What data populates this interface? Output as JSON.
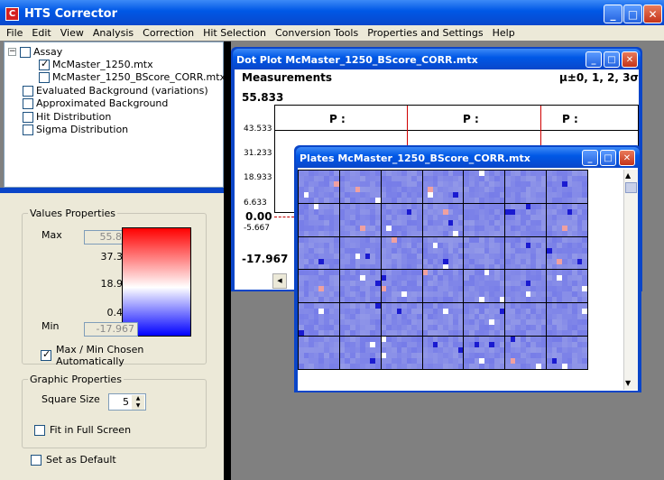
{
  "app": {
    "title": "HTS Corrector",
    "icon_letter": "C"
  },
  "menu": [
    "File",
    "Edit",
    "View",
    "Analysis",
    "Correction",
    "Hit Selection",
    "Conversion Tools",
    "Properties and Settings",
    "Help"
  ],
  "tree": {
    "root": "Assay",
    "items": [
      {
        "label": "McMaster_1250.mtx",
        "checked": true
      },
      {
        "label": "McMaster_1250_BScore_CORR.mtx",
        "checked": false
      }
    ],
    "options": [
      "Evaluated Background (variations)",
      "Approximated Background",
      "Hit Distribution",
      "Sigma Distribution"
    ]
  },
  "values_properties": {
    "legend": "Values Properties",
    "max_label": "Max",
    "max_value": "55.833",
    "min_label": "Min",
    "min_value": "-17.967",
    "gradient_labels": [
      "37.383",
      "18.933",
      "0.483"
    ],
    "auto_label": "Max / Min Chosen Automatically",
    "auto_checked": true,
    "colors": {
      "high": "#ff0000",
      "mid": "#ffffff",
      "low": "#0000ff"
    }
  },
  "graphic_properties": {
    "legend": "Graphic Properties",
    "square_size_label": "Square Size",
    "square_size_value": "5",
    "fit_label": "Fit in Full Screen"
  },
  "set_default_label": "Set as Default",
  "dotplot": {
    "title": "Dot Plot McMaster_1250_BScore_CORR.mtx",
    "measurements_label": "Measurements",
    "sigma_label": "μ±0, 1, 2, 3σ",
    "y_top": "55.833",
    "y_bottom": "-17.967",
    "ticks": [
      "43.533",
      "31.233",
      "18.933",
      "6.633",
      "0.00",
      "-5.667"
    ],
    "columns": [
      "P :",
      "P :",
      "P :"
    ]
  },
  "plates": {
    "title": "Plates McMaster_1250_BScore_CORR.mtx",
    "rows": 6,
    "cols": 7,
    "base_color": "#7f84e6"
  }
}
